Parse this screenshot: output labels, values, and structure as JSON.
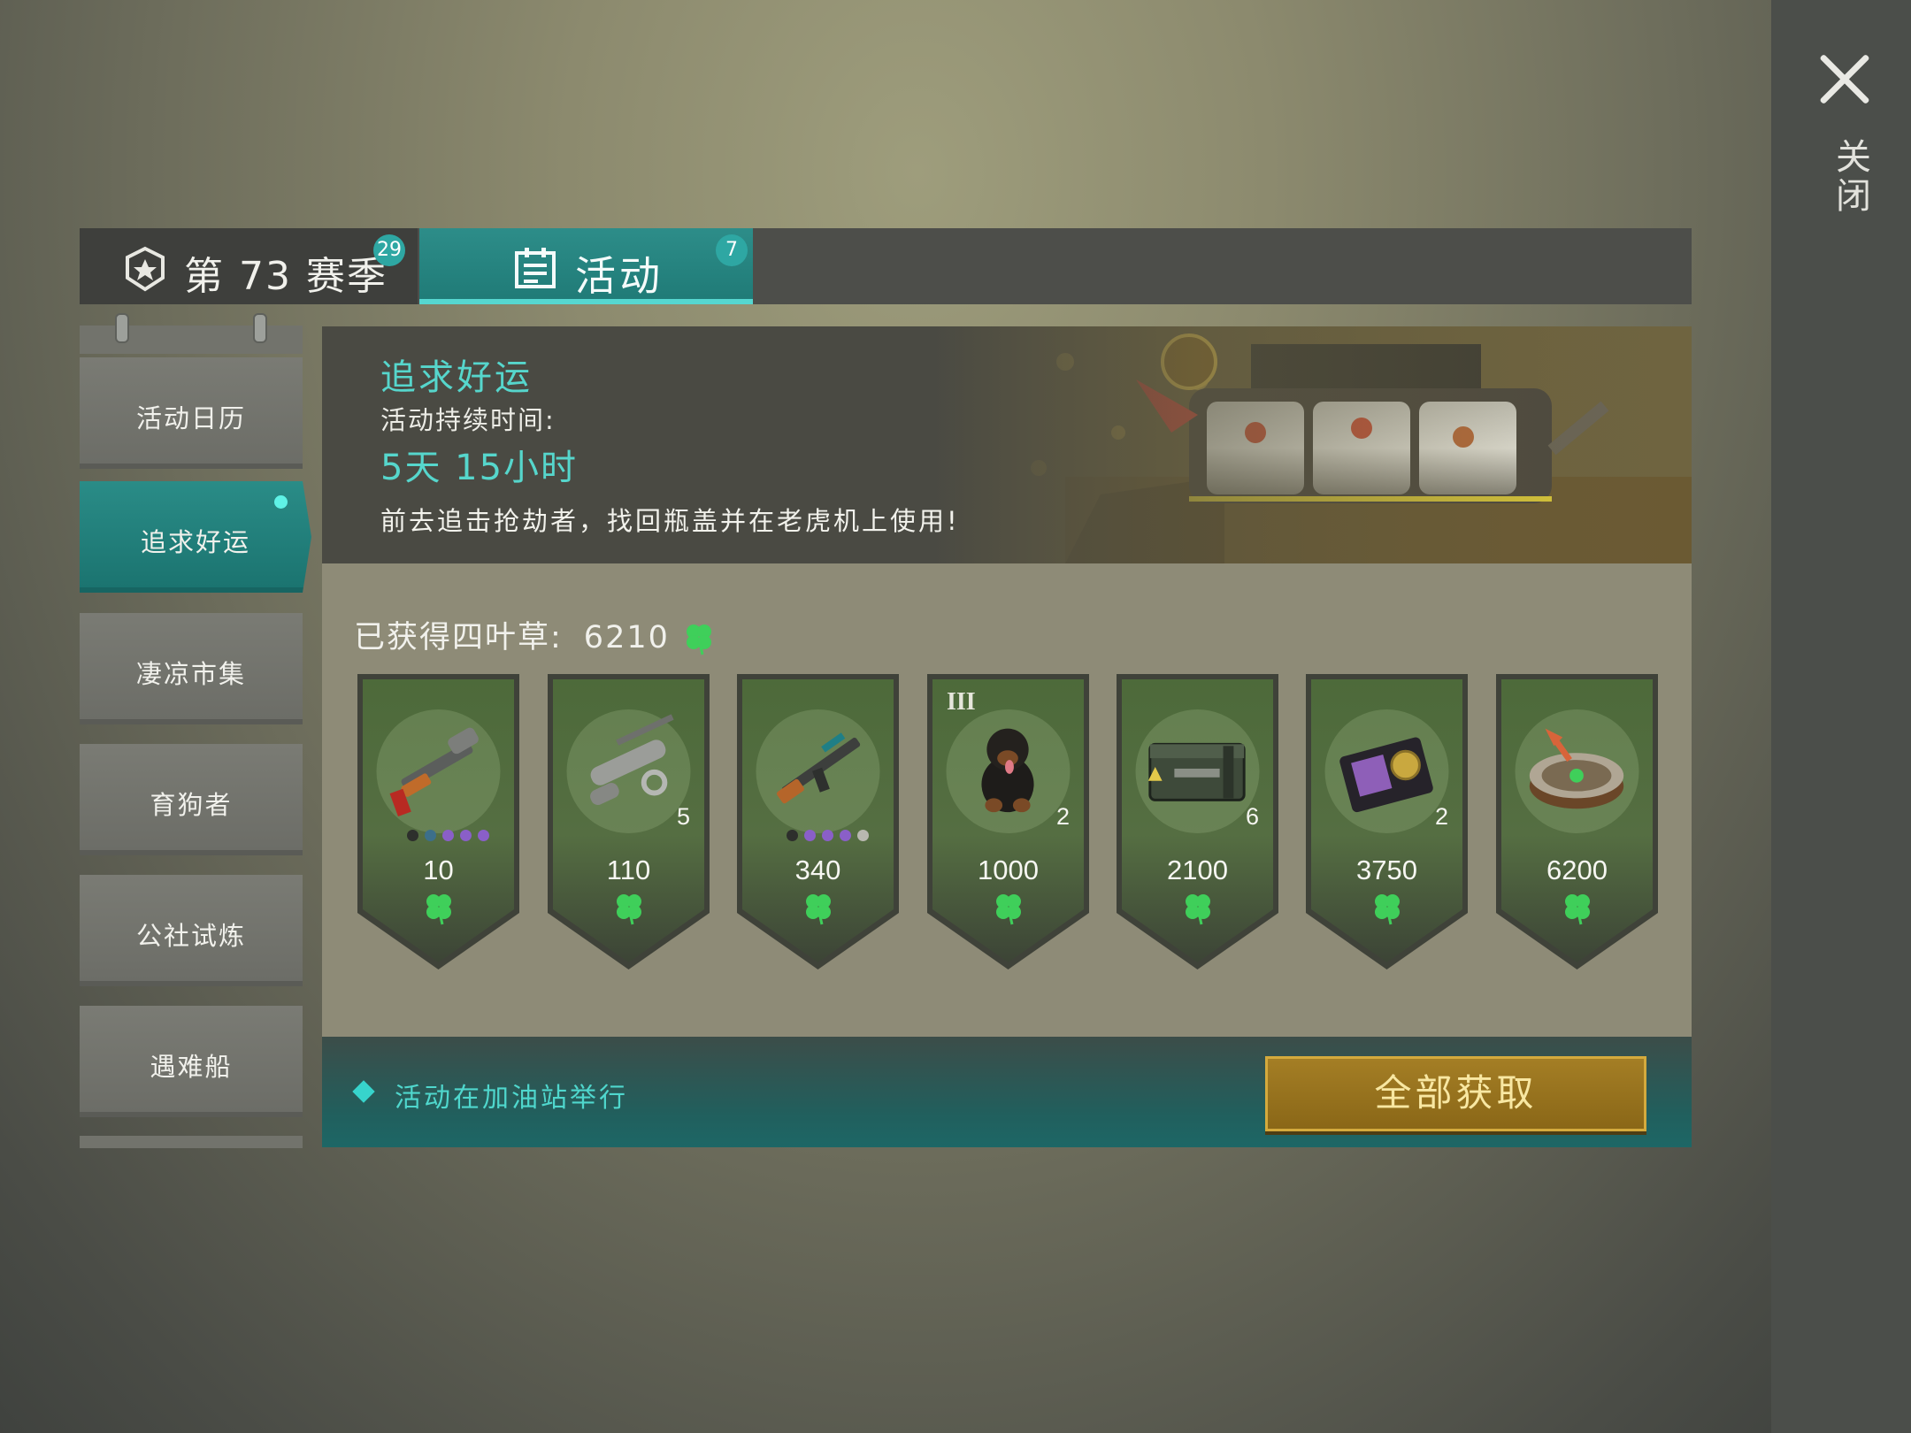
{
  "close": {
    "label": "关闭"
  },
  "tabs": [
    {
      "label": "第 73 赛季",
      "badge": "29"
    },
    {
      "label": "活动",
      "badge": "7"
    }
  ],
  "sidebar": {
    "items": [
      {
        "label": "活动日历"
      },
      {
        "label": "追求好运"
      },
      {
        "label": "凄凉市集"
      },
      {
        "label": "育狗者"
      },
      {
        "label": "公社试炼"
      },
      {
        "label": "遇难船"
      }
    ]
  },
  "banner": {
    "title": "追求好运",
    "duration_label": "活动持续时间:",
    "duration": "5天 15小时",
    "description": "前去追击抢劫者，找回瓶盖并在老虎机上使用!"
  },
  "progress": {
    "label": "已获得四叶草:",
    "value": "6210"
  },
  "rewards": [
    {
      "name": "shotgun",
      "cost": "10",
      "quantity": "",
      "tier": ""
    },
    {
      "name": "rocket-launcher-parts",
      "cost": "110",
      "quantity": "5",
      "tier": ""
    },
    {
      "name": "assault-rifle",
      "cost": "340",
      "quantity": "",
      "tier": ""
    },
    {
      "name": "rottweiler-dog",
      "cost": "1000",
      "quantity": "2",
      "tier": "III"
    },
    {
      "name": "weapon-crate",
      "cost": "2100",
      "quantity": "6",
      "tier": ""
    },
    {
      "name": "police-badge-wallet",
      "cost": "3750",
      "quantity": "2",
      "tier": ""
    },
    {
      "name": "roulette-wheel",
      "cost": "6200",
      "quantity": "",
      "tier": ""
    }
  ],
  "footer": {
    "location_text": "活动在加油站举行",
    "claim_all_label": "全部获取"
  },
  "colors": {
    "accent_teal": "#2a8c87",
    "clover_green": "#3fcf5a",
    "claim_gold": "#a47e25"
  }
}
